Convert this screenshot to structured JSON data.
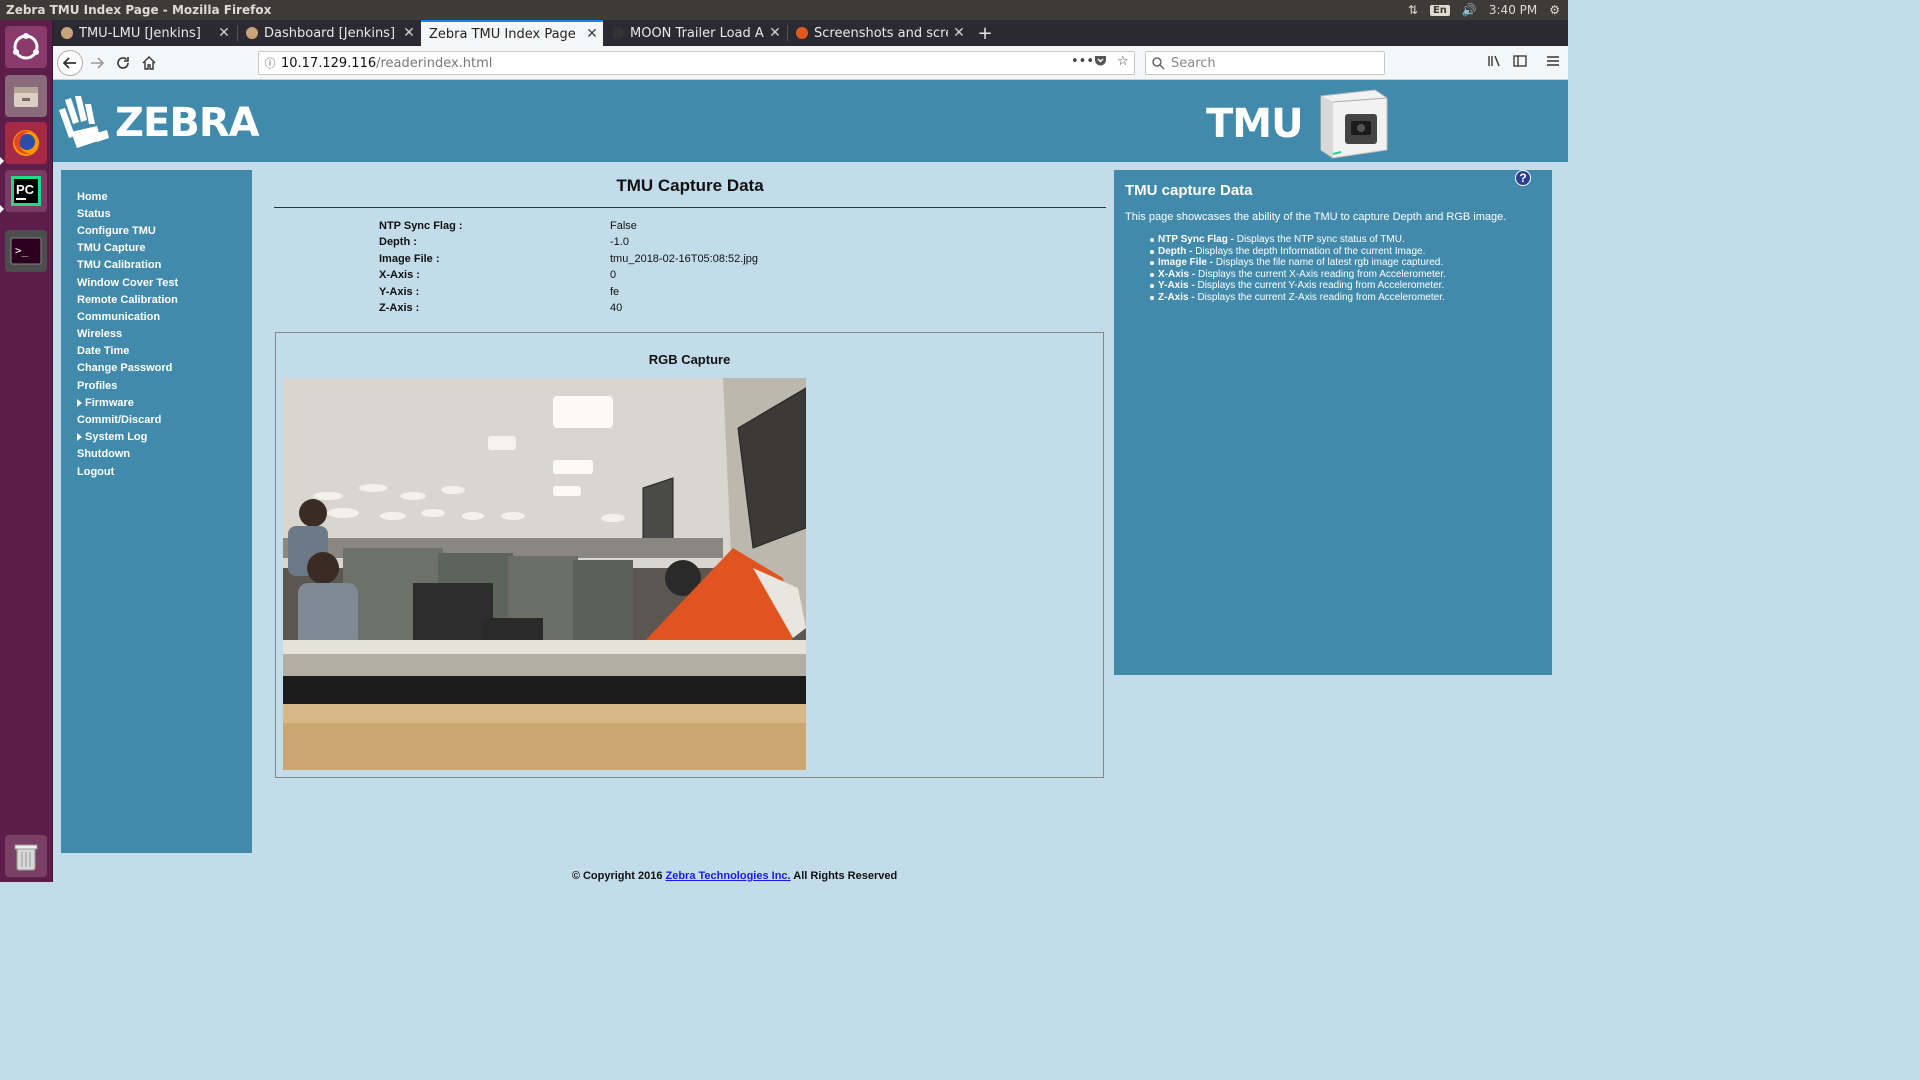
{
  "os": {
    "window_title": "Zebra TMU Index Page - Mozilla Firefox",
    "tray": {
      "language": "En",
      "time": "3:40 PM"
    },
    "launcher": [
      {
        "name": "ubuntu-icon"
      },
      {
        "name": "files-icon"
      },
      {
        "name": "firefox-icon"
      },
      {
        "name": "pycharm-icon",
        "label": "PC"
      },
      {
        "name": "terminal-icon",
        "label": ">_"
      },
      {
        "name": "trash-icon"
      }
    ]
  },
  "browser": {
    "tabs": [
      {
        "label": "TMU-LMU [Jenkins]",
        "active": false,
        "favicon_color": "#c9a37a"
      },
      {
        "label": "Dashboard [Jenkins]",
        "active": false,
        "favicon_color": "#c9a37a"
      },
      {
        "label": "Zebra TMU Index Page",
        "active": true,
        "favicon_color": ""
      },
      {
        "label": "MOON Trailer Load Ana",
        "active": false,
        "favicon_color": "#333333"
      },
      {
        "label": "Screenshots and screen",
        "active": false,
        "favicon_color": "#e2591f"
      }
    ],
    "new_tab_label": "+",
    "url": {
      "host": "10.17.129.116",
      "path": "/readerindex.html"
    },
    "search_placeholder": "Search"
  },
  "page": {
    "brand": {
      "left_logo": "ZEBRA",
      "right_logo": "TMU"
    },
    "menu": [
      {
        "label": "Home",
        "expandable": false
      },
      {
        "label": "Status",
        "expandable": false
      },
      {
        "label": "Configure TMU",
        "expandable": false
      },
      {
        "label": "TMU Capture",
        "expandable": false
      },
      {
        "label": "TMU Calibration",
        "expandable": false
      },
      {
        "label": "Window Cover Test",
        "expandable": false
      },
      {
        "label": "Remote Calibration",
        "expandable": false
      },
      {
        "label": "Communication",
        "expandable": false
      },
      {
        "label": "Wireless",
        "expandable": false
      },
      {
        "label": "Date Time",
        "expandable": false
      },
      {
        "label": "Change Password",
        "expandable": false
      },
      {
        "label": "Profiles",
        "expandable": false
      },
      {
        "label": "Firmware",
        "expandable": true
      },
      {
        "label": "Commit/Discard",
        "expandable": false
      },
      {
        "label": "System Log",
        "expandable": true
      },
      {
        "label": "Shutdown",
        "expandable": false
      },
      {
        "label": "Logout",
        "expandable": false
      }
    ],
    "main": {
      "title": "TMU Capture Data",
      "fields": [
        {
          "label": "NTP Sync Flag :",
          "value": "False"
        },
        {
          "label": "Depth :",
          "value": "-1.0"
        },
        {
          "label": "Image File :",
          "value": "tmu_2018-02-16T05:08:52.jpg"
        },
        {
          "label": "X-Axis :",
          "value": "0"
        },
        {
          "label": "Y-Axis :",
          "value": "fe"
        },
        {
          "label": "Z-Axis :",
          "value": "40"
        }
      ],
      "rgb_title": "RGB Capture"
    },
    "help": {
      "title": "TMU capture Data",
      "icon_label": "?",
      "intro": "This page showcases the ability of the TMU to capture Depth and RGB image.",
      "items": [
        {
          "term": "NTP Sync Flag -",
          "desc": " Displays the NTP sync status of TMU."
        },
        {
          "term": "Depth -",
          "desc": " Displays the depth Information of the current Image."
        },
        {
          "term": "Image File -",
          "desc": " Displays the file name of latest rgb image captured."
        },
        {
          "term": "X-Axis -",
          "desc": " Displays the current X-Axis reading from Accelerometer."
        },
        {
          "term": "Y-Axis -",
          "desc": " Displays the current Y-Axis reading from Accelerometer."
        },
        {
          "term": "Z-Axis -",
          "desc": " Displays the current Z-Axis reading from Accelerometer."
        }
      ]
    },
    "footer": {
      "prefix": "© Copyright 2016 ",
      "link": "Zebra Technologies Inc.",
      "suffix": " All Rights Reserved"
    },
    "colors": {
      "header": "#418aab",
      "page_bg": "#c3dcea",
      "accent_tab": "#0a84ff"
    }
  }
}
